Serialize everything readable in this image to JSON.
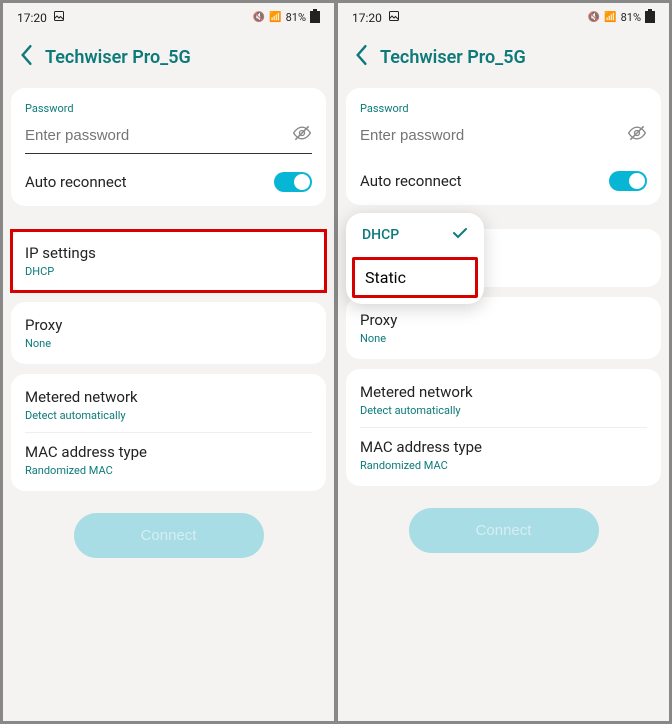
{
  "status": {
    "time": "17:20",
    "battery": "81%"
  },
  "header": {
    "title": "Techwiser Pro_5G"
  },
  "password": {
    "label": "Password",
    "placeholder": "Enter password"
  },
  "auto_reconnect": {
    "label": "Auto reconnect"
  },
  "ip_settings": {
    "title": "IP settings",
    "value": "DHCP"
  },
  "proxy": {
    "title": "Proxy",
    "value": "None"
  },
  "metered": {
    "title": "Metered network",
    "value": "Detect automatically"
  },
  "mac": {
    "title": "MAC address type",
    "value": "Randomized MAC"
  },
  "connect": {
    "label": "Connect"
  },
  "dropdown": {
    "selected": "DHCP",
    "other": "Static"
  }
}
